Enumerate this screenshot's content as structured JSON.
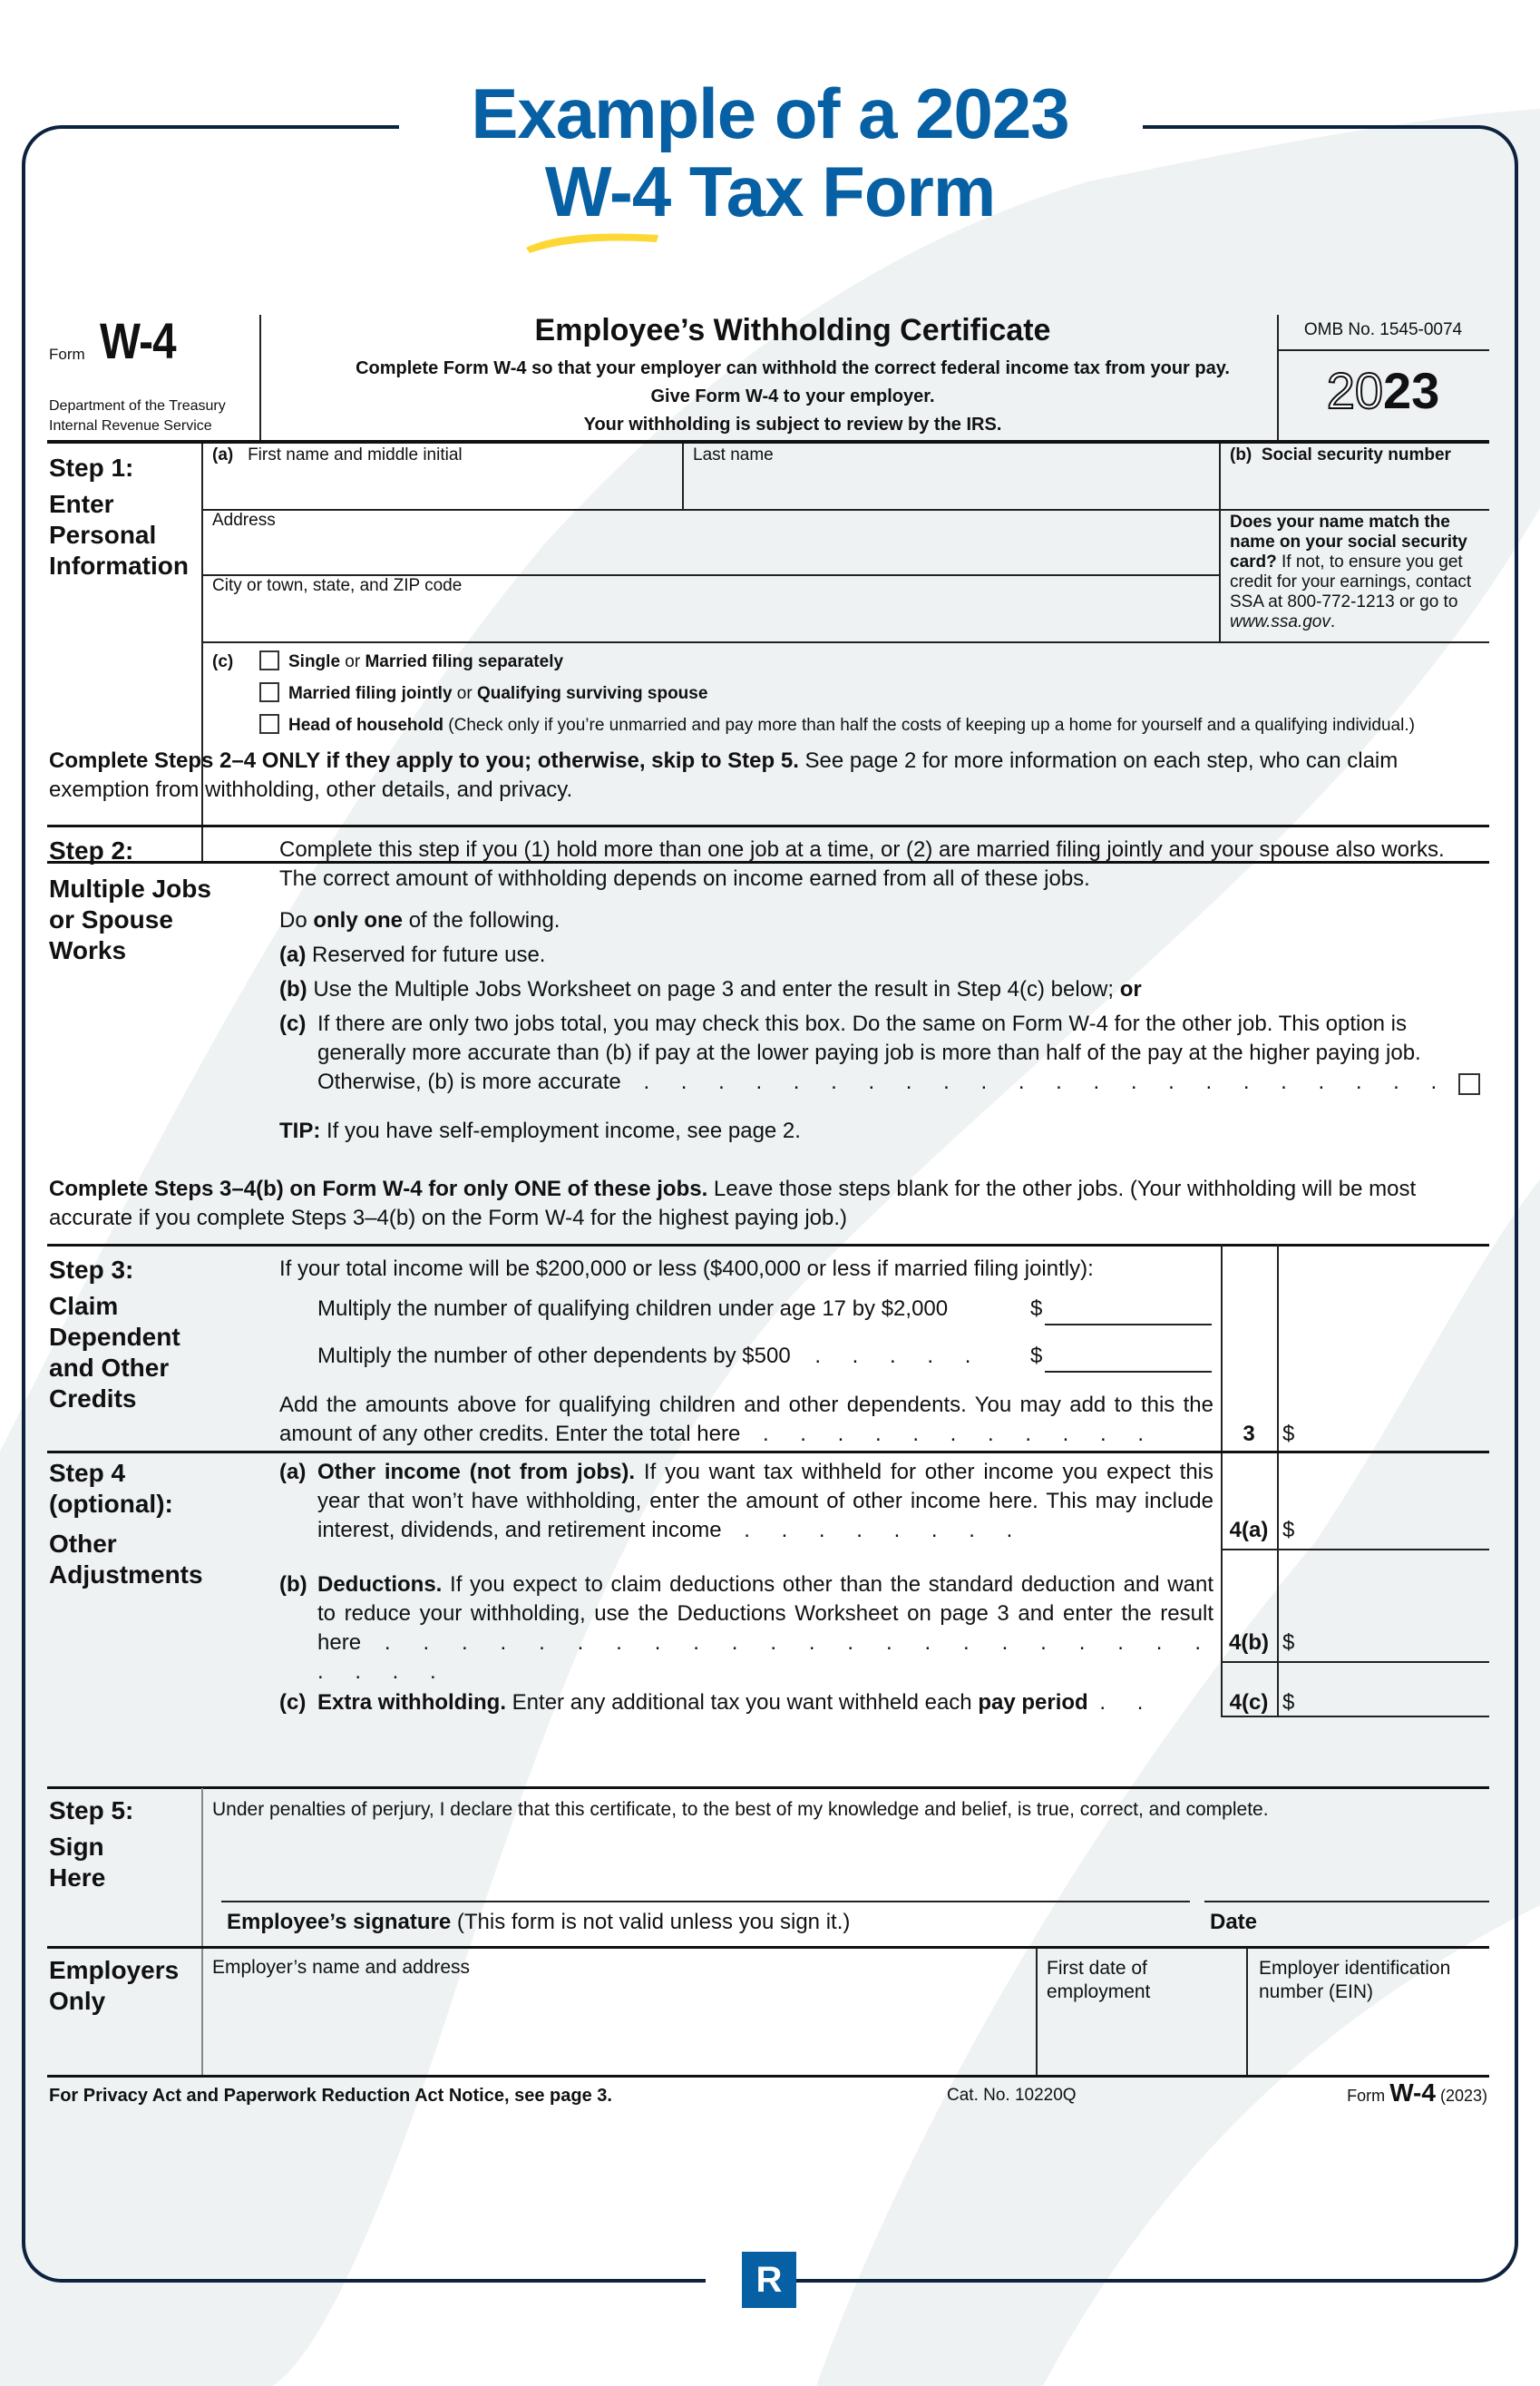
{
  "page": {
    "title_line1": "Example of a 2023",
    "title_line2": "W-4 Tax Form",
    "colors": {
      "brand_blue": "#0660a3",
      "frame_navy": "#0d223f",
      "accent_yellow": "#fdd835",
      "swash_gray": "#eef2f3"
    },
    "logo_letter": "R"
  },
  "form": {
    "form_word": "Form",
    "form_name": "W-4",
    "dept_line1": "Department of the Treasury",
    "dept_line2": "Internal Revenue Service",
    "heading": "Employee’s Withholding Certificate",
    "sub1": "Complete Form W-4 so that your employer can withhold the correct federal income tax from your pay.",
    "sub2": "Give Form W-4 to your employer.",
    "sub3": "Your withholding is subject to review by the IRS.",
    "omb": "OMB No. 1545-0074",
    "year_outline": "20",
    "year_bold": "23"
  },
  "step1": {
    "label": "Step 1:",
    "title_lines": [
      "Enter",
      "Personal",
      "Information"
    ],
    "a_marker": "(a)",
    "first_name_label": "First name and middle initial",
    "last_name_label": "Last name",
    "b_marker": "(b)",
    "ssn_label": "Social security number",
    "address_label": "Address",
    "city_label": "City or town, state, and ZIP code",
    "ssa_note_bold": "Does your name match the name on your social security card?",
    "ssa_note_rest": " If not, to ensure you get credit for your earnings, contact SSA at 800-772-1213 or go to ",
    "ssa_note_link": "www.ssa.gov",
    "ssa_note_end": ".",
    "c_marker": "(c)",
    "filing_status": [
      {
        "bold1": "Single",
        "mid": " or ",
        "bold2": "Married filing separately",
        "rest": ""
      },
      {
        "bold1": "Married filing jointly",
        "mid": " or ",
        "bold2": "Qualifying surviving spouse",
        "rest": ""
      },
      {
        "bold1": "Head of household",
        "mid": "",
        "bold2": "",
        "rest": " (Check only if you’re unmarried and pay more than half the costs of keeping up a home for yourself and a qualifying individual.)"
      }
    ]
  },
  "notice1": {
    "bold": "Complete Steps 2–4 ONLY if they apply to you; otherwise, skip to Step 5.",
    "rest": " See page 2 for more information on each step, who can claim exemption from withholding, other details, and privacy."
  },
  "step2": {
    "label": "Step 2:",
    "title_lines": [
      "Multiple Jobs",
      "or Spouse",
      "Works"
    ],
    "intro": "Complete this step if you (1) hold more than one job at a time, or (2) are married filing jointly and your spouse also works. The correct amount of withholding depends on income earned from all of these jobs.",
    "do_pre": "Do ",
    "do_bold": "only one",
    "do_post": " of the following.",
    "a_marker": "(a)",
    "a_text": "Reserved for future use.",
    "b_marker": "(b)",
    "b_text": "Use the Multiple Jobs Worksheet on page 3 and enter the result in Step 4(c) below; ",
    "b_or": "or",
    "c_marker": "(c)",
    "c_text": "If there are only two jobs total, you may check this box. Do the same on Form W-4 for the other job. This option is generally more accurate than (b) if pay at the lower paying job is more than half of the pay at the higher paying job. Otherwise, (b) is more accurate",
    "c_dots": ". . . . . . . . . . . . . . . . . . . . . .",
    "tip_bold": "TIP:",
    "tip_text": " If you have self-employment income, see page 2."
  },
  "notice2": {
    "bold": "Complete Steps 3–4(b) on Form W-4 for only ONE of these jobs.",
    "rest": " Leave those steps blank for the other jobs. (Your withholding will be most accurate if you complete Steps 3–4(b) on the Form W-4 for the highest paying job.)"
  },
  "step3": {
    "label": "Step 3:",
    "title_lines": [
      "Claim",
      "Dependent",
      "and Other",
      "Credits"
    ],
    "intro": "If your total income will be $200,000 or less ($400,000 or less if married filing jointly):",
    "children_text": "Multiply the number of qualifying children under age 17 by $2,000",
    "others_text": "Multiply the number of other dependents by $500",
    "others_dots": ". . . . .",
    "currency": "$",
    "total_text": "Add the amounts above for qualifying children and other dependents. You may add to this the amount of any other credits. Enter the total here",
    "total_dots": ". . . . . . . . . . .",
    "line_no": "3"
  },
  "step4": {
    "label": "Step 4",
    "label2": "(optional):",
    "title_lines": [
      "Other",
      "Adjustments"
    ],
    "a_marker": "(a)",
    "a_bold": "Other income (not from jobs).",
    "a_text": " If you want tax withheld for other income you expect this year that won’t have withholding, enter the amount of other income here. This may include interest, dividends, and retirement income",
    "a_dots": ". . . . . . . .",
    "a_line": "4(a)",
    "b_marker": "(b)",
    "b_bold": "Deductions.",
    "b_text": " If you expect to claim deductions other than the standard deduction and want to reduce your withholding, use the Deductions Worksheet on page 3 and enter the result here",
    "b_dots": ". . . . . . . . . . . . . . . . . . . . . . . . . .",
    "b_line": "4(b)",
    "c_marker": "(c)",
    "c_bold": "Extra withholding.",
    "c_text": " Enter any additional tax you want withheld each ",
    "c_bold2": "pay period",
    "c_dots": ". .",
    "c_line": "4(c)",
    "currency": "$"
  },
  "step5": {
    "label": "Step 5:",
    "title_lines": [
      "Sign",
      "Here"
    ],
    "perjury": "Under penalties of perjury, I declare that this certificate, to the best of my knowledge and belief, is true, correct, and complete.",
    "sig_bold": "Employee’s signature",
    "sig_rest": " (This form is not valid unless you sign it.)",
    "date_label": "Date"
  },
  "employers": {
    "title_lines": [
      "Employers",
      "Only"
    ],
    "name_label": "Employer’s name and address",
    "first_date_label": "First date of employment",
    "ein_label": "Employer identification number (EIN)"
  },
  "footer": {
    "privacy": "For Privacy Act and Paperwork Reduction Act Notice, see page 3.",
    "cat": "Cat. No. 10220Q",
    "form_word": "Form",
    "form_name": "W-4",
    "form_year": "(2023)"
  }
}
